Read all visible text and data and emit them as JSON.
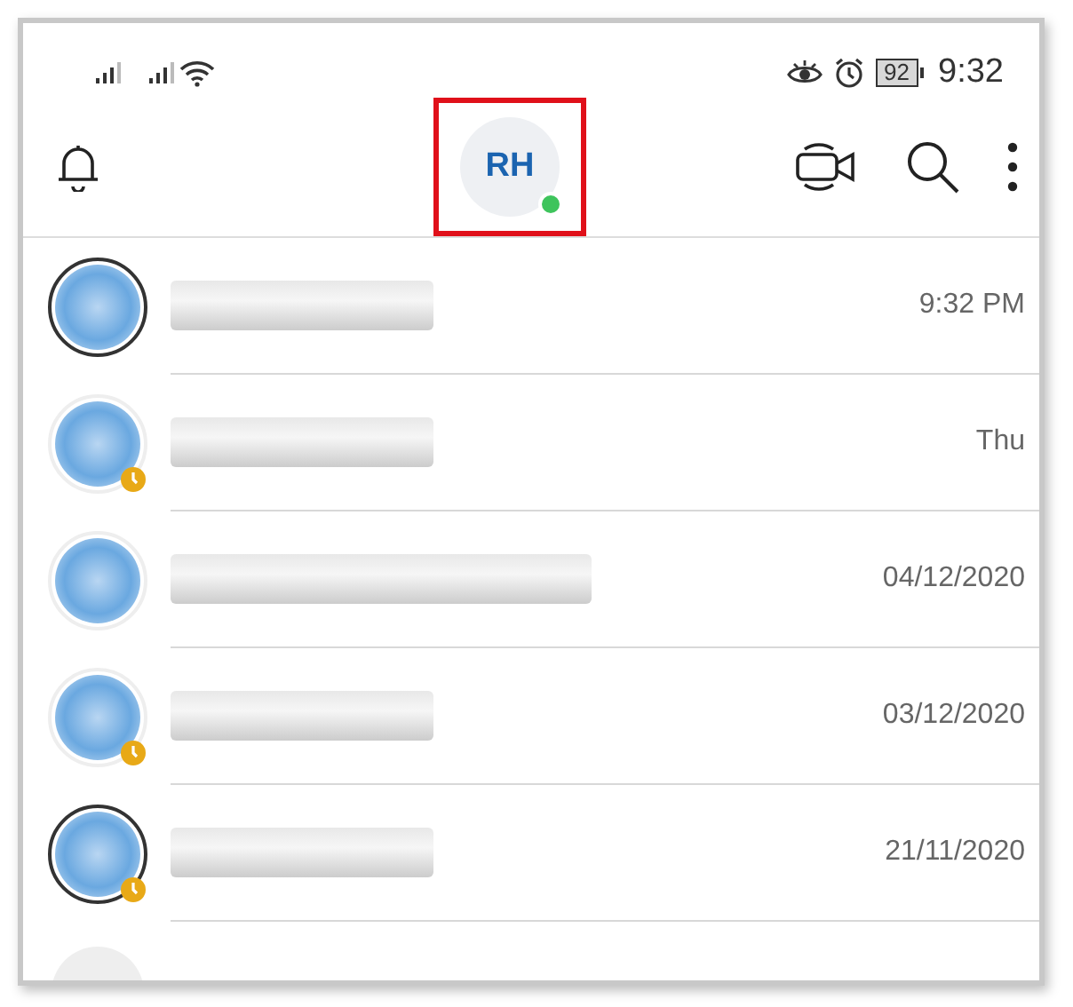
{
  "status_bar": {
    "battery": "92",
    "time": "9:32"
  },
  "header": {
    "initials": "RH",
    "online": true,
    "highlighted": true
  },
  "conversations": [
    {
      "time": "9:32 PM",
      "story": true,
      "badge": false,
      "kind": "short"
    },
    {
      "time": "Thu",
      "story": false,
      "badge": true,
      "kind": "short"
    },
    {
      "time": "04/12/2020",
      "story": false,
      "badge": false,
      "kind": "long"
    },
    {
      "time": "03/12/2020",
      "story": false,
      "badge": true,
      "kind": "short"
    },
    {
      "time": "21/11/2020",
      "story": true,
      "badge": true,
      "kind": "short"
    }
  ]
}
